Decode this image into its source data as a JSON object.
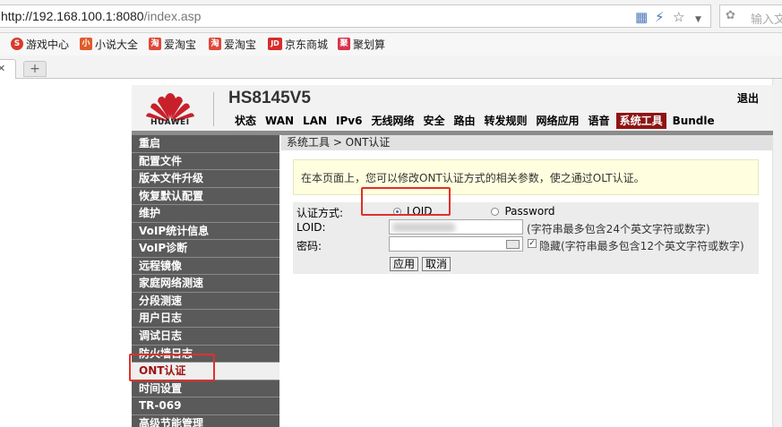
{
  "browser": {
    "url_main": "http://192.168.100.1:8080",
    "url_path": "/index.asp",
    "search_placeholder": "输入文",
    "favorites": [
      {
        "label": "游戏中心",
        "icon_color": "#d83a2c",
        "icon": "game-center-icon"
      },
      {
        "label": "小说大全",
        "icon_color": "#e05a2a",
        "icon": "novel-icon"
      },
      {
        "label": "爱淘宝",
        "icon_color": "#e0483a",
        "icon": "taobao-icon"
      },
      {
        "label": "爱淘宝",
        "icon_color": "#e0483a",
        "icon": "taobao-icon"
      },
      {
        "label": "京东商城",
        "icon_color": "#d82b2b",
        "icon": "jd-icon"
      },
      {
        "label": "聚划算",
        "icon_color": "#d8334a",
        "icon": "juhuasuan-icon"
      }
    ],
    "fav_glyphs": [
      "S",
      "小",
      "淘",
      "淘",
      "JD",
      "聚"
    ]
  },
  "router": {
    "model": "HS8145V5",
    "brand": "HUAWEI",
    "logout": "退出",
    "nav": [
      "状态",
      "WAN",
      "LAN",
      "IPv6",
      "无线网络",
      "安全",
      "路由",
      "转发规则",
      "网络应用",
      "语音",
      "系统工具",
      "Bundle"
    ],
    "nav_active": "系统工具",
    "sidebar": [
      "重启",
      "配置文件",
      "版本文件升级",
      "恢复默认配置",
      "维护",
      "VoIP统计信息",
      "VoIP诊断",
      "远程镜像",
      "家庭网络测速",
      "分段测速",
      "用户日志",
      "调试日志",
      "防火墙日志",
      "ONT认证",
      "时间设置",
      "TR-069",
      "高级节能管理"
    ],
    "sidebar_active": "ONT认证",
    "breadcrumb": "系统工具 > ONT认证",
    "info": "在本页面上，您可以修改ONT认证方式的相关参数，使之通过OLT认证。",
    "form": {
      "auth_label": "认证方式:",
      "option_loid": "LOID",
      "option_password": "Password",
      "selected": "LOID",
      "loid_label": "LOID:",
      "loid_hint": "(字符串最多包含24个英文字符或数字)",
      "password_label": "密码:",
      "hide_label": "隐藏(字符串最多包含12个英文字符或数字)",
      "hide_checked": true,
      "apply": "应用",
      "cancel": "取消"
    }
  },
  "colors": {
    "accent": "#8e1515",
    "sidebar_bg": "#5a5a5a",
    "highlight": "#e0302a",
    "logo_red": "#c8202a"
  }
}
